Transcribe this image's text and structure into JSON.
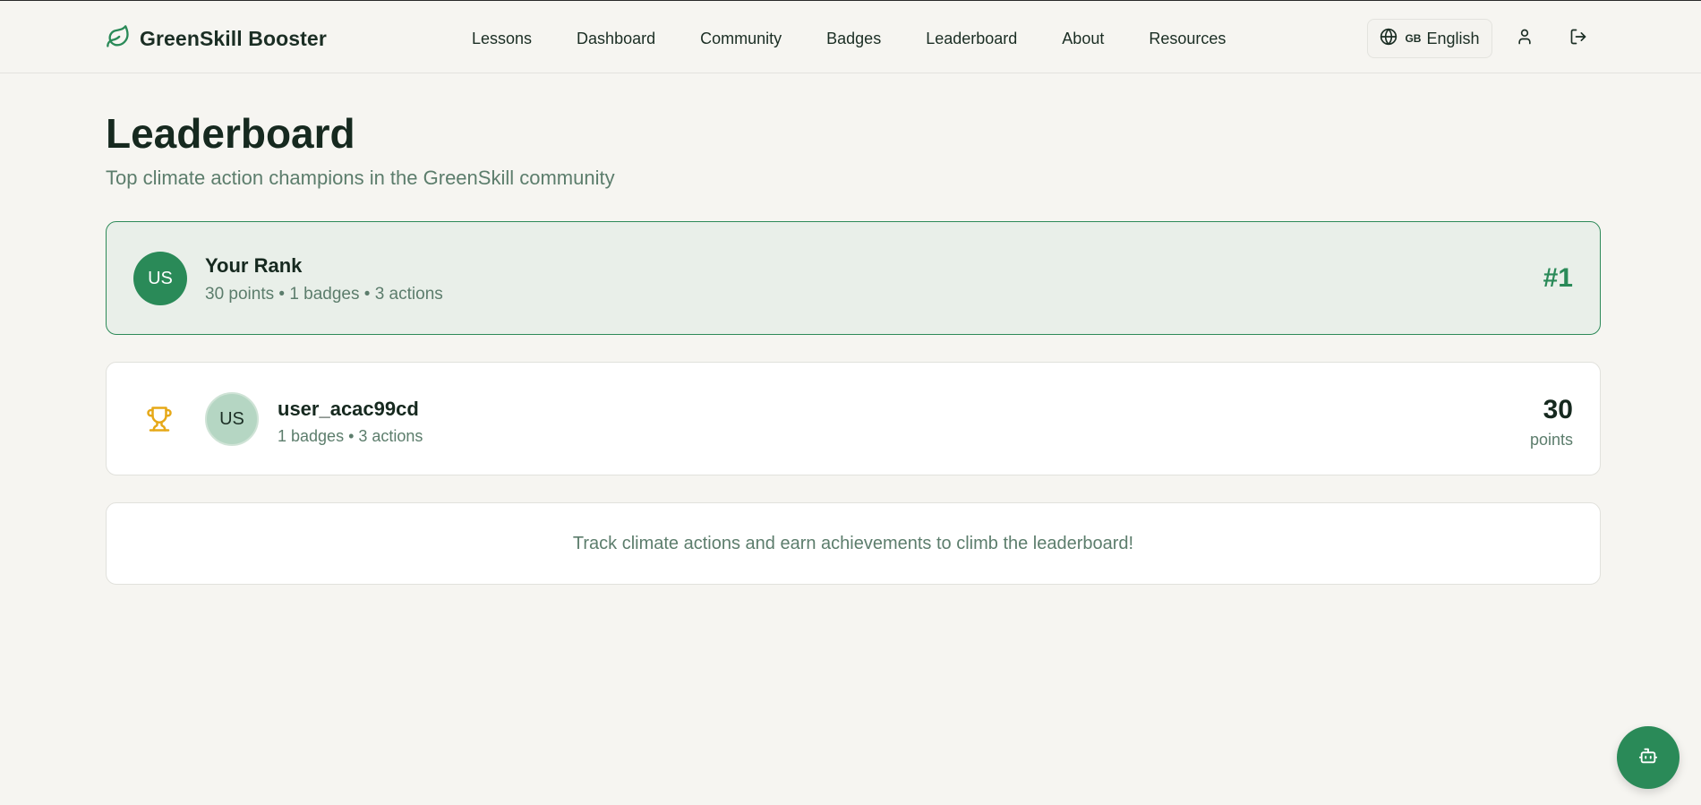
{
  "header": {
    "brand": "GreenSkill Booster",
    "nav": [
      "Lessons",
      "Dashboard",
      "Community",
      "Badges",
      "Leaderboard",
      "About",
      "Resources"
    ],
    "language": {
      "flag": "GB",
      "label": "English"
    },
    "icons": {
      "logo": "leaf-icon",
      "language": "globe-icon",
      "profile": "user-icon",
      "logout": "logout-icon"
    }
  },
  "main": {
    "title": "Leaderboard",
    "subtitle": "Top climate action champions in the GreenSkill community",
    "your_rank": {
      "avatar": "US",
      "label": "Your Rank",
      "stats": "30 points • 1 badges • 3 actions",
      "rank": "#1"
    },
    "entries": [
      {
        "icon": "trophy-icon",
        "avatar": "US",
        "name": "user_acac99cd",
        "stats": "1 badges • 3 actions",
        "points": "30",
        "points_label": "points"
      }
    ],
    "info": "Track climate actions and earn achievements to climb the leaderboard!"
  },
  "fab": {
    "icon": "bot-icon"
  },
  "colors": {
    "accent": "#2a8a58",
    "background": "#f6f5f1",
    "muted_text": "#5c7d6c",
    "trophy": "#e6a817"
  }
}
